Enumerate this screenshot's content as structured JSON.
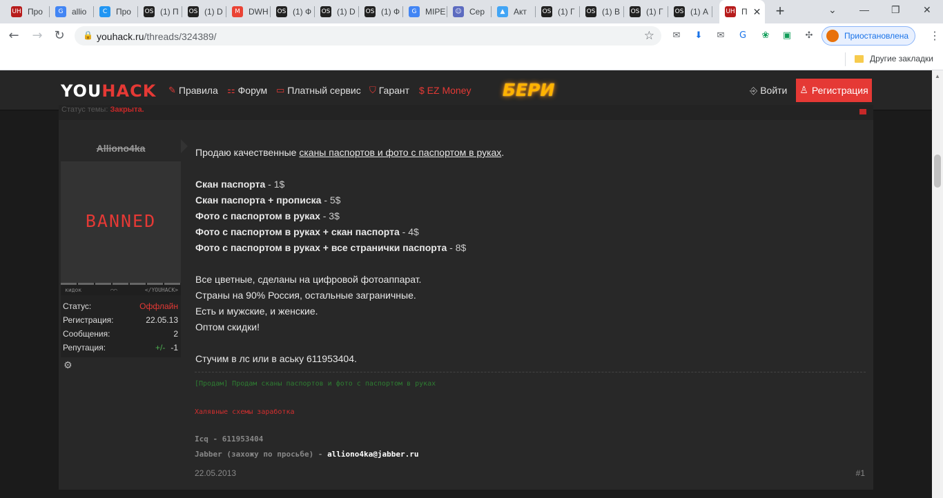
{
  "browser": {
    "tabs": [
      {
        "label": "Про",
        "fav": "UH",
        "color": "#b71c1c"
      },
      {
        "label": "allio",
        "fav": "G",
        "color": "#4285f4"
      },
      {
        "label": "Про",
        "fav": "C",
        "color": "#2196f3"
      },
      {
        "label": "(1) П",
        "fav": "ОS",
        "color": "#212121"
      },
      {
        "label": "(1) D",
        "fav": "ОS",
        "color": "#212121"
      },
      {
        "label": "DWH",
        "fav": "M",
        "color": "#ea4335"
      },
      {
        "label": "(1) Ф",
        "fav": "ОS",
        "color": "#212121"
      },
      {
        "label": "(1) D",
        "fav": "ОS",
        "color": "#212121"
      },
      {
        "label": "(1) Ф",
        "fav": "ОS",
        "color": "#212121"
      },
      {
        "label": "MIPE",
        "fav": "G",
        "color": "#4285f4"
      },
      {
        "label": "Сер",
        "fav": "☺",
        "color": "#5c6bc0"
      },
      {
        "label": "Акт",
        "fav": "▲",
        "color": "#42a5f5"
      },
      {
        "label": "(1) Г",
        "fav": "ОS",
        "color": "#212121"
      },
      {
        "label": "(1) В",
        "fav": "ОS",
        "color": "#212121"
      },
      {
        "label": "(1) Г",
        "fav": "ОS",
        "color": "#212121"
      },
      {
        "label": "(1) А",
        "fav": "ОS",
        "color": "#212121"
      },
      {
        "label": "П",
        "fav": "UH",
        "color": "#b71c1c",
        "active": true
      }
    ],
    "url_host": "youhack.ru",
    "url_path": "/threads/324389/",
    "profile_status": "Приостановлена",
    "bookmarks_folder": "Другие закладки"
  },
  "site": {
    "logo_you": "YOU",
    "logo_hack": "HACK",
    "nav": {
      "rules": "Правила",
      "forum": "Форум",
      "paid": "Платный сервис",
      "guarantor": "Гарант",
      "ez": "$ EZ Money"
    },
    "promo": "БЕРИ",
    "login": "Войти",
    "register": "Регистрация"
  },
  "thread": {
    "status_label": "Статус темы:",
    "status_value": "Закрыта."
  },
  "post": {
    "username": "Alliono4ka",
    "avatar_text": "BANNED",
    "rank_left": "кидок",
    "rank_right": "</YOUHACK>",
    "stats": {
      "status_label": "Статус:",
      "status_value": "Оффлайн",
      "reg_label": "Регистрация:",
      "reg_value": "22.05.13",
      "msg_label": "Сообщения:",
      "msg_value": "2",
      "rep_label": "Репутация:",
      "rep_plus": "+/-",
      "rep_value": "-1"
    },
    "intro_pre": "Продаю качественные ",
    "intro_link": "сканы паспортов и фото с паспортом в руках",
    "intro_post": ".",
    "prices": [
      {
        "item": "Скан паспорта",
        "price": " - 1$"
      },
      {
        "item": "Скан паспорта + прописка",
        "price": " - 5$"
      },
      {
        "item": "Фото с паспортом в руках",
        "price": " - 3$"
      },
      {
        "item": "Фото с паспортом в руках + скан паспорта",
        "price": " - 4$"
      },
      {
        "item": "Фото с паспортом в руках + все странички паспорта",
        "price": " - 8$"
      }
    ],
    "lines": [
      "Все цветные, сделаны на цифровой фотоаппарат.",
      "Страны на 90% Россия, остальные заграничные.",
      "Есть и мужские, и женские.",
      "Оптом скидки!"
    ],
    "contact": "Стучим в лс или в аську 611953404.",
    "sig_link": "[Продам] Продам сканы паспортов и фото с паспортом в руках",
    "sig_red": "Халявные схемы заработка",
    "sig_icq": "Icq - 611953404",
    "sig_jabber": "Jabber (захожу по просьбе) - ",
    "sig_jabber_mail": "alliono4ka@jabber.ru",
    "date": "22.05.2013",
    "number": "#1"
  }
}
